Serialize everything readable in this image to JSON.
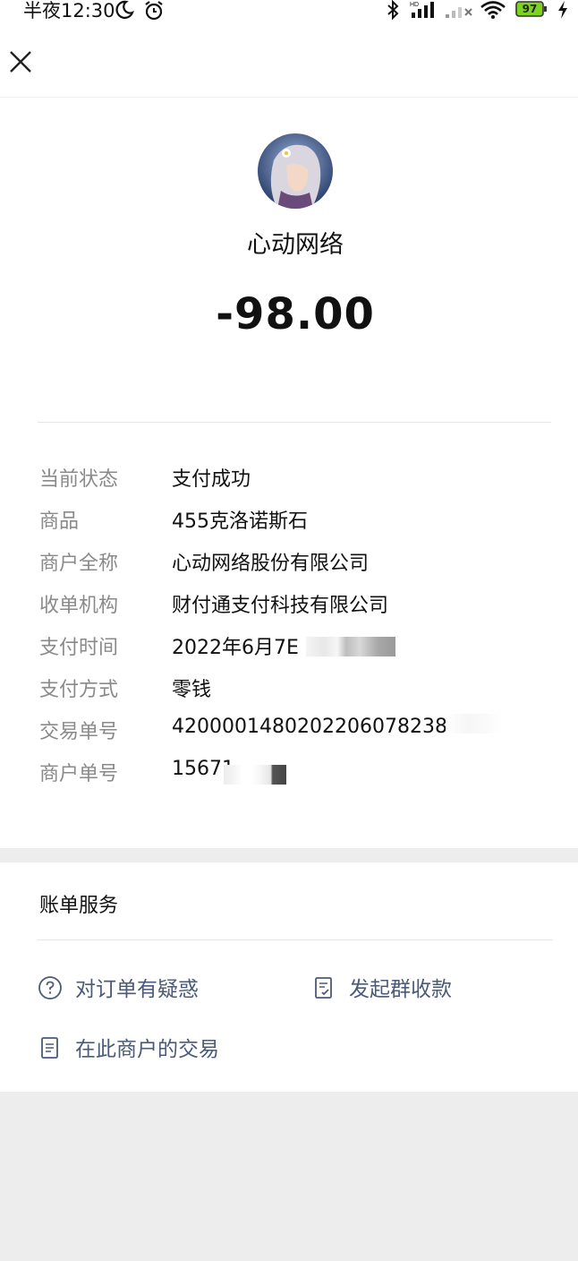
{
  "status_bar": {
    "time": "半夜12:30",
    "battery": "97"
  },
  "merchant": {
    "name": "心动网络",
    "amount": "-98.00"
  },
  "details": [
    {
      "label": "当前状态",
      "value": "支付成功"
    },
    {
      "label": "商品",
      "value": "455克洛诺斯石"
    },
    {
      "label": "商户全称",
      "value": "心动网络股份有限公司"
    },
    {
      "label": "收单机构",
      "value": "财付通支付科技有限公司"
    },
    {
      "label": "支付时间",
      "value": "2022年6月7E"
    },
    {
      "label": "支付方式",
      "value": "零钱"
    },
    {
      "label": "交易单号",
      "value": "42000014802022060782383"
    },
    {
      "label": "商户单号",
      "value": "15671"
    }
  ],
  "services": {
    "title": "账单服务",
    "items": [
      {
        "label": "对订单有疑惑",
        "icon": "question-circle-icon"
      },
      {
        "label": "发起群收款",
        "icon": "doc-check-icon"
      },
      {
        "label": "在此商户的交易",
        "icon": "doc-list-icon"
      }
    ]
  }
}
